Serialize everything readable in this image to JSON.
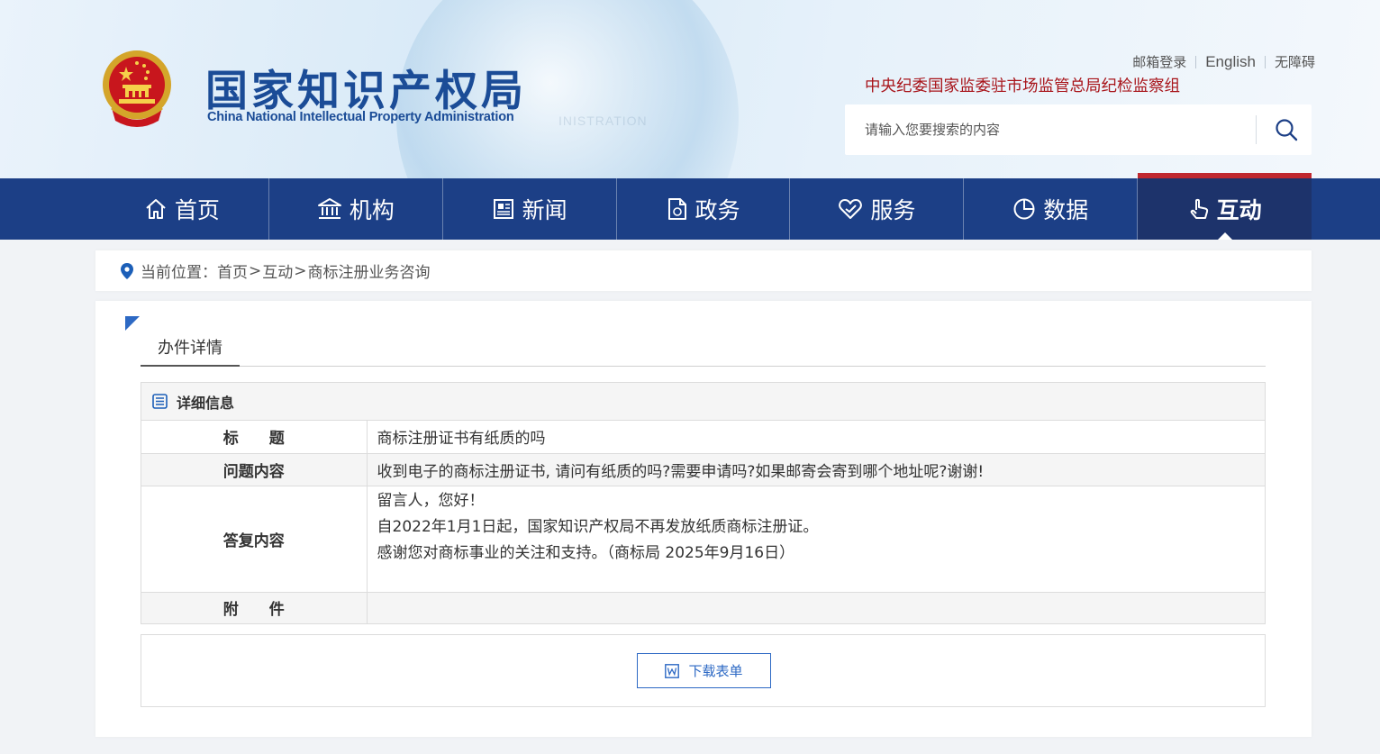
{
  "header": {
    "logo_cn": "国家知识产权局",
    "logo_en": "China National Intellectual Property Administration",
    "links": [
      "邮箱登录",
      "English",
      "无障碍"
    ],
    "discipline_link": "中央纪委国家监委驻市场监管总局纪检监察组",
    "search_placeholder": "请输入您要搜索的内容"
  },
  "nav": {
    "items": [
      {
        "label": "首页",
        "icon": "home-icon"
      },
      {
        "label": "机构",
        "icon": "institution-icon"
      },
      {
        "label": "新闻",
        "icon": "news-icon"
      },
      {
        "label": "政务",
        "icon": "document-icon"
      },
      {
        "label": "服务",
        "icon": "heart-service-icon"
      },
      {
        "label": "数据",
        "icon": "pie-chart-icon"
      },
      {
        "label": "互动",
        "icon": "hand-pointer-icon"
      }
    ],
    "active": "互动"
  },
  "breadcrumb": {
    "label": "当前位置：",
    "items": [
      "首页",
      "互动",
      "商标注册业务咨询"
    ],
    "separator": ">"
  },
  "tab": {
    "label": "办件详情"
  },
  "detail": {
    "heading": "详细信息",
    "rows": [
      {
        "key": "标　　题",
        "value": "商标注册证书有纸质的吗"
      },
      {
        "key": "问题内容",
        "value": "收到电子的商标注册证书, 请问有纸质的吗?需要申请吗?如果邮寄会寄到哪个地址呢?谢谢!"
      },
      {
        "key": "答复内容",
        "lines": [
          "留言人，您好！",
          "自2022年1月1日起，国家知识产权局不再发放纸质商标注册证。",
          "感谢您对商标事业的关注和支持。（商标局 2025年9月16日）"
        ]
      },
      {
        "key": "附　　件",
        "value": ""
      }
    ]
  },
  "download": {
    "label": "下载表单"
  },
  "colors": {
    "nav_bg": "#1c3f86",
    "nav_active_bg": "#1d336b",
    "accent_red": "#c0282f",
    "link_blue": "#2d69c4",
    "brand_blue": "#1b4c97"
  }
}
